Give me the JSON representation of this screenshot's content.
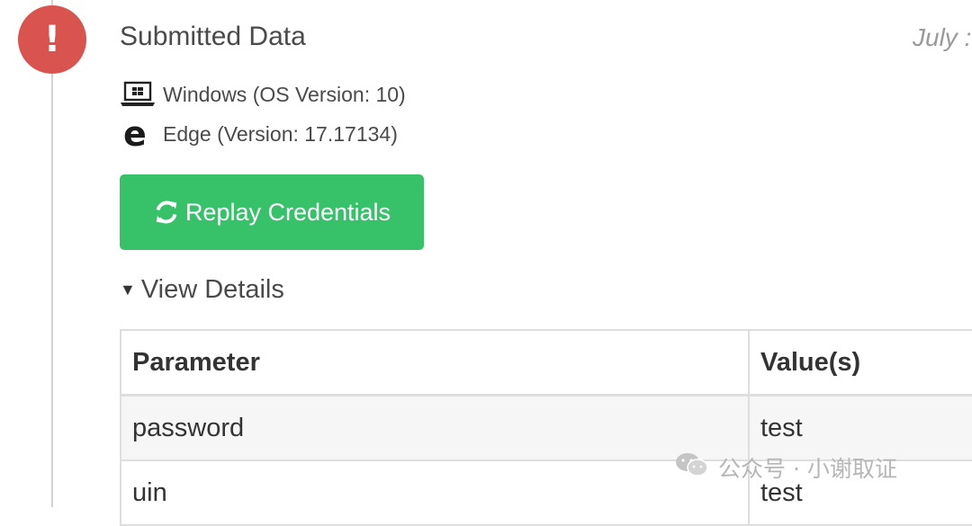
{
  "event": {
    "badge_icon": "exclamation-icon",
    "badge_glyph": "!",
    "badge_color": "#d9534f",
    "title": "Submitted Data",
    "date": "July :"
  },
  "client": {
    "os_icon": "laptop-windows-icon",
    "os": "Windows (OS Version: 10)",
    "browser_icon": "edge-browser-icon",
    "browser_glyph": "e",
    "browser": "Edge (Version: 17.17134)"
  },
  "actions": {
    "replay_icon": "refresh-icon",
    "replay_label": "Replay Credentials",
    "replay_color": "#37c26a"
  },
  "details": {
    "toggle_icon": "caret-down-icon",
    "toggle_label": "View Details",
    "columns": [
      "Parameter",
      "Value(s)"
    ],
    "rows": [
      {
        "parameter": "password",
        "value": "test"
      },
      {
        "parameter": "uin",
        "value": "test"
      }
    ]
  },
  "watermark": {
    "icon": "wechat-icon",
    "text": "公众号 · 小谢取证"
  }
}
